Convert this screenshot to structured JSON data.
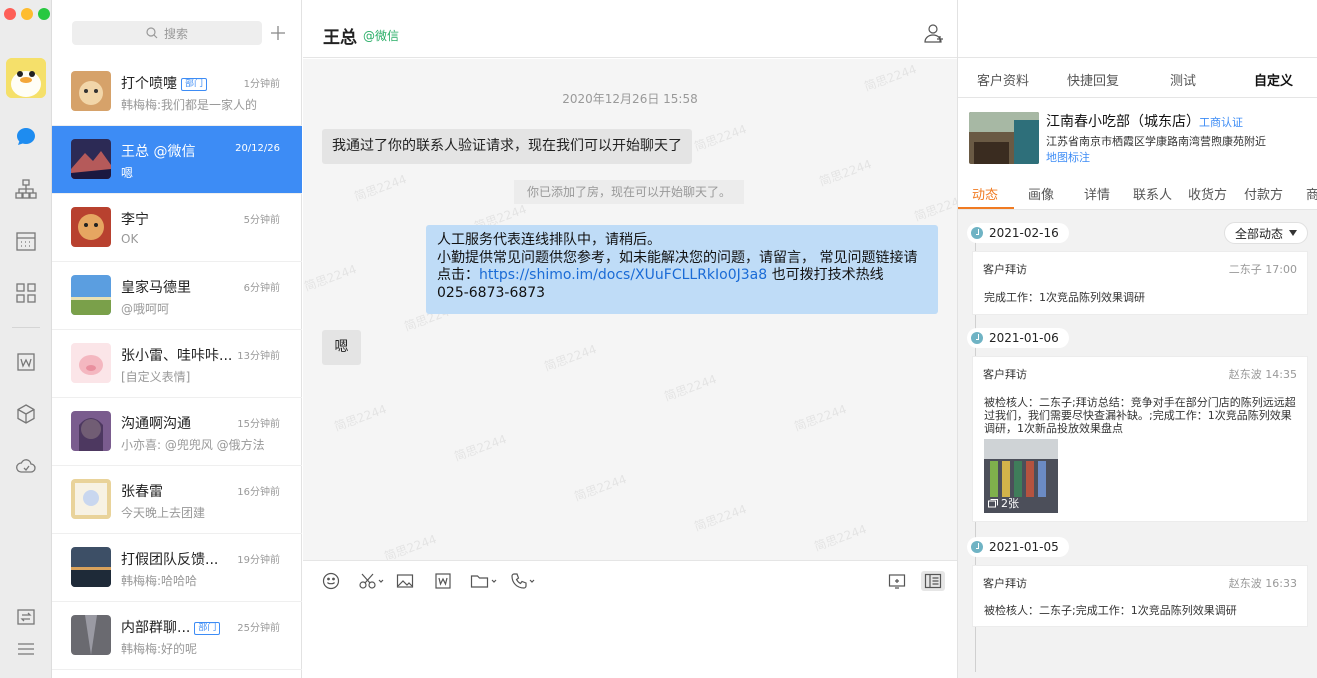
{
  "conversations": {
    "search_placeholder": "搜索",
    "items": [
      {
        "name": "打个喷嚏",
        "badge": "部门",
        "time": "1分钟前",
        "preview": "韩梅梅:我们都是一家人的"
      },
      {
        "name": "王总 @微信",
        "badge": "",
        "time": "20/12/26",
        "preview": "嗯"
      },
      {
        "name": "李宁",
        "badge": "",
        "time": "5分钟前",
        "preview": "OK"
      },
      {
        "name": "皇家马德里",
        "badge": "",
        "time": "6分钟前",
        "preview": "@哦呵呵"
      },
      {
        "name": "张小雷、哇咔咔...",
        "badge": "",
        "time": "13分钟前",
        "preview": "[自定义表情]"
      },
      {
        "name": "沟通啊沟通",
        "badge": "",
        "time": "15分钟前",
        "preview": "小亦喜: @兜兜风 @俄方法"
      },
      {
        "name": "张春雷",
        "badge": "",
        "time": "16分钟前",
        "preview": "今天晚上去团建"
      },
      {
        "name": "打假团队反馈...",
        "badge": "",
        "time": "19分钟前",
        "preview": "韩梅梅:哈哈哈"
      },
      {
        "name": "内部群聊...",
        "badge": "部门",
        "time": "25分钟前",
        "preview": "韩梅梅:好的呢"
      }
    ]
  },
  "chat": {
    "title": "王总",
    "subtitle": "@微信",
    "watermark": "简思2244",
    "timestamp": "2020年12月26日 15:58",
    "msg1": "我通过了你的联系人验证请求，现在我们可以开始聊天了",
    "system_msg": "你已添加了房，现在可以开始聊天了。",
    "out_line1": "人工服务代表连线排队中，请稍后。",
    "out_line2": "小勤提供常见问题供您参考，如未能解决您的问题，请留言， 常见问题链接请点击：",
    "out_link": "https://shimo.im/docs/XUuFCLLRkIo0J3a8",
    "out_line3": " 也可拨打技术热线",
    "out_line4": "025-6873-6873",
    "msg2": "嗯"
  },
  "panel": {
    "tabs": [
      "客户资料",
      "快捷回复",
      "测试",
      "自定义"
    ],
    "customer": {
      "name": "江南春小吃部（城东店）",
      "cert": "工商认证",
      "address": "江苏省南京市栖霞区学康路南湾营煦康苑附近",
      "map_link": "地图标注"
    },
    "subtabs": [
      "动态",
      "画像",
      "详情",
      "联系人",
      "收货方",
      "付款方",
      "商"
    ],
    "filter": "全部动态",
    "timeline": [
      {
        "date": "2021-02-16",
        "title": "客户拜访",
        "meta": "二东子 17:00",
        "body": "完成工作：1次竞品陈列效果调研"
      },
      {
        "date": "2021-01-06",
        "title": "客户拜访",
        "meta": "赵东波 14:35",
        "body": "被检核人：二东子;拜访总结：竞争对手在部分门店的陈列远远超过我们，我们需要尽快查漏补缺。;完成工作：1次竞品陈列效果调研，1次新品投放效果盘点",
        "photo_count": "2张"
      },
      {
        "date": "2021-01-05",
        "title": "客户拜访",
        "meta": "赵东波 16:33",
        "body": "被检核人：二东子;完成工作：1次竞品陈列效果调研"
      }
    ]
  }
}
